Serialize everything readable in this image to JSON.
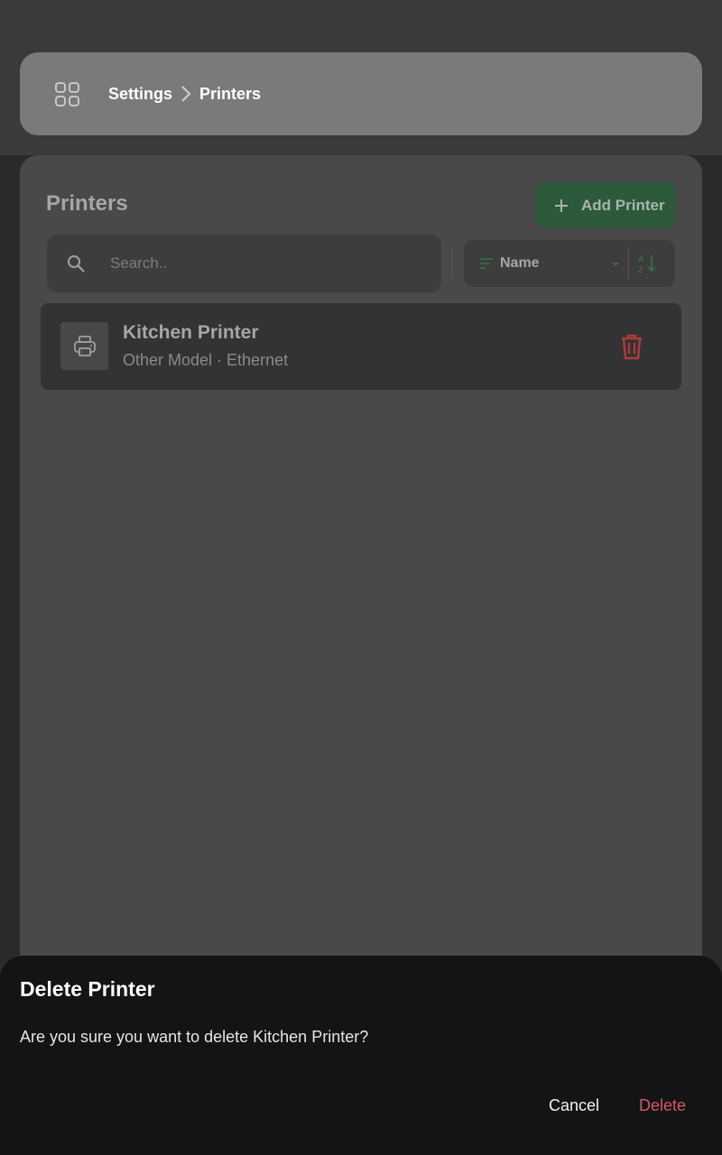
{
  "header": {
    "breadcrumb": {
      "parent": "Settings",
      "current": "Printers"
    }
  },
  "main": {
    "title": "Printers",
    "add_button_label": "Add Printer",
    "search": {
      "placeholder": "Search.."
    },
    "sort": {
      "selected": "Name"
    },
    "printers": [
      {
        "name": "Kitchen Printer",
        "subtitle": "Other Model · Ethernet"
      }
    ]
  },
  "dialog": {
    "title": "Delete Printer",
    "message": "Are you sure you want to delete Kitchen Printer?",
    "cancel_label": "Cancel",
    "delete_label": "Delete"
  },
  "colors": {
    "accent_green": "#2d5a3a",
    "danger_red": "#d2586b",
    "trash_red": "#e03a3a"
  },
  "icons": {
    "menu": "apps-grid-icon",
    "separator": "chevron-right-icon",
    "add": "plus-icon",
    "search": "search-icon",
    "sort": "sort-lines-icon",
    "caret": "caret-down-icon",
    "order": "sort-az-icon",
    "printer": "printer-icon",
    "delete": "trash-icon"
  }
}
